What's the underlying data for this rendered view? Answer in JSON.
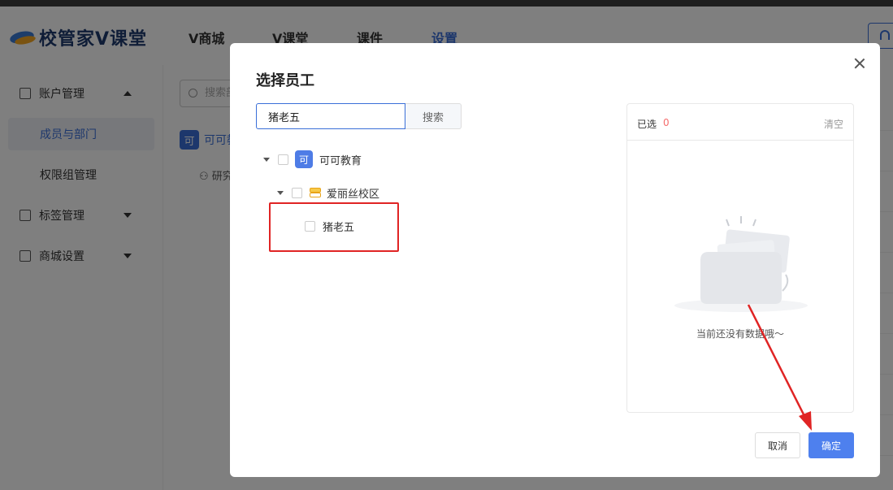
{
  "header": {
    "logo_text": "校管家V课堂",
    "nav": [
      "V商城",
      "V课堂",
      "课件",
      "设置"
    ],
    "active_nav": "设置"
  },
  "sidebar": {
    "account": "账户管理",
    "members": "成员与部门",
    "permissions": "权限组管理",
    "tags": "标签管理",
    "mall": "商城设置"
  },
  "dept_panel": {
    "search_placeholder": "搜索部",
    "root_badge": "可",
    "root_label": "可可教",
    "child_label": "研究"
  },
  "modal": {
    "title": "选择员工",
    "search_value": "猪老五",
    "search_button": "搜索",
    "tree": {
      "org_badge": "可",
      "org_name": "可可教育",
      "campus": "爱丽丝校区",
      "employee": "猪老五"
    },
    "selected": {
      "label": "已选",
      "count": "0",
      "clear": "清空",
      "empty_text": "当前还没有数据哦～"
    },
    "cancel": "取消",
    "confirm": "确定"
  },
  "colors": {
    "primary": "#4e80ee",
    "highlight": "#e02424",
    "count": "#f56c6c"
  }
}
